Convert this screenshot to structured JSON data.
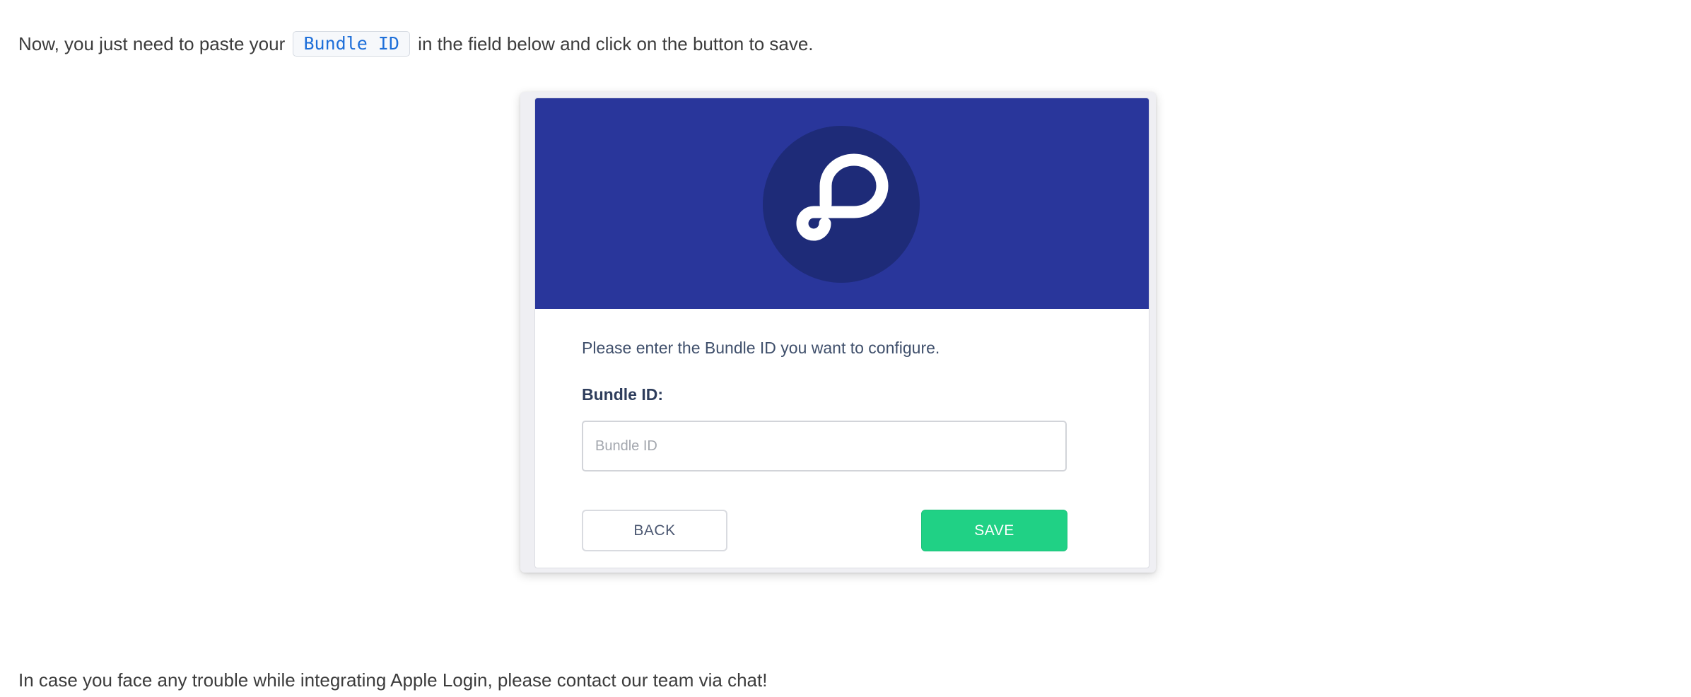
{
  "intro": {
    "before": "Now, you just need to paste your",
    "code": "Bundle ID",
    "after": "in the field below and click on the button to save."
  },
  "card": {
    "logo_icon": "parse-logo-icon",
    "instruction": "Please enter the Bundle ID you want to configure.",
    "field_label": "Bundle ID:",
    "input_value": "",
    "input_placeholder": "Bundle ID",
    "back_label": "BACK",
    "save_label": "SAVE"
  },
  "footer": {
    "text": "In case you face any trouble while integrating Apple Login, please contact our team via chat!"
  },
  "colors": {
    "header_bg": "#29369b",
    "logo_circle": "#1e2b78",
    "save_button": "#20d185",
    "code_text": "#1e6fd9"
  }
}
